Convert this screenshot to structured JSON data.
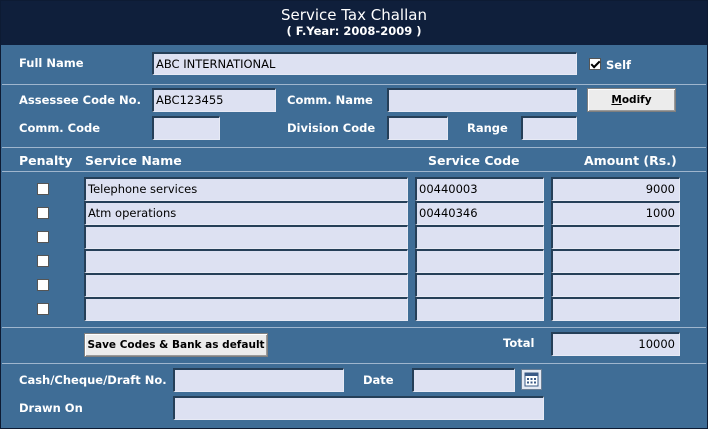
{
  "window": {
    "title": "Service Tax Challan",
    "subtitle": "( F.Year: 2008-2009 )"
  },
  "form": {
    "full_name_label": "Full Name",
    "full_name_value": "ABC INTERNATIONAL",
    "self_label": "Self",
    "self_checked": true,
    "assessee_code_label": "Assessee Code No.",
    "assessee_code_value": "ABC123455",
    "comm_name_label": "Comm. Name",
    "comm_name_value": "",
    "modify_label_first": "M",
    "modify_label_rest": "odify",
    "comm_code_label": "Comm. Code",
    "comm_code_value": "",
    "division_code_label": "Division Code",
    "division_code_value": "",
    "range_label": "Range",
    "range_value": ""
  },
  "table": {
    "columns": {
      "penalty": "Penalty",
      "service_name": "Service Name",
      "service_code": "Service Code",
      "amount": "Amount (Rs.)"
    },
    "rows": [
      {
        "penalty": false,
        "service_name": "Telephone services",
        "service_code": "00440003",
        "amount": "9000"
      },
      {
        "penalty": false,
        "service_name": "Atm operations",
        "service_code": "00440346",
        "amount": "1000"
      },
      {
        "penalty": false,
        "service_name": "",
        "service_code": "",
        "amount": ""
      },
      {
        "penalty": false,
        "service_name": "",
        "service_code": "",
        "amount": ""
      },
      {
        "penalty": false,
        "service_name": "",
        "service_code": "",
        "amount": ""
      },
      {
        "penalty": false,
        "service_name": "",
        "service_code": "",
        "amount": ""
      }
    ]
  },
  "footer": {
    "save_defaults_label": "Save Codes & Bank as default",
    "total_label": "Total",
    "total_value": "10000",
    "cheque_label": "Cash/Cheque/Draft No.",
    "cheque_value": "",
    "date_label": "Date",
    "date_value": "",
    "drawn_on_label": "Drawn On",
    "drawn_on_value": ""
  },
  "icons": {
    "calendar": "calendar-icon",
    "checkbox": "checkbox"
  }
}
